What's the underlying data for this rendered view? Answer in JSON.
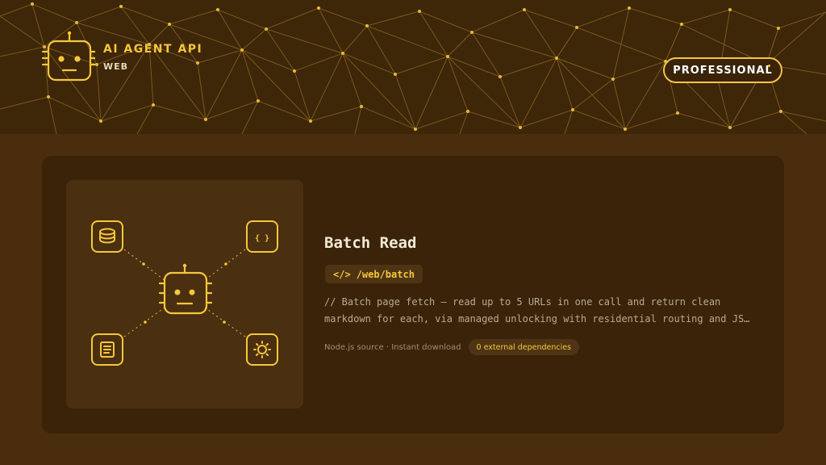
{
  "brand": {
    "title": "AI AGENT API",
    "subtitle": "WEB",
    "icon": "robot-icon"
  },
  "tier": {
    "label": "PROFESSIONAL"
  },
  "endpoint": {
    "title": "Batch Read",
    "path_icon": "</>",
    "path": "/web/batch",
    "description": "// Batch page fetch — read up to 5 URLs in one call and return clean markdown for each, via managed unlocking with residential routing and JS…",
    "source_info": "Node.js source · Instant download",
    "dependencies": "0 external dependencies"
  },
  "diagram": {
    "center": "robot-icon",
    "nodes": [
      "database-icon",
      "json-braces-icon",
      "document-icon",
      "network-hub-icon"
    ],
    "json_glyph": "{ }"
  },
  "colors": {
    "accent": "#f5c73a",
    "header_bg": "#3e2609",
    "page_bg": "#4a2d0c",
    "card_bg": "#3a2308",
    "tile_bg": "#4a2f11"
  }
}
